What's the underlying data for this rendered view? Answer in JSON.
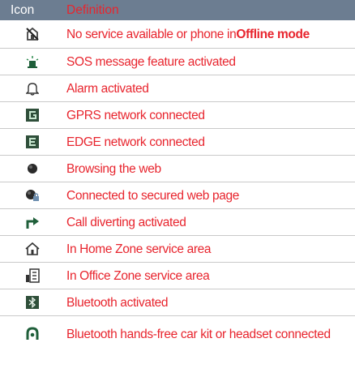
{
  "header": {
    "icon": "Icon",
    "definition": "Definition"
  },
  "rows": [
    {
      "icon": "no-service-icon",
      "text": "No service available or phone in ",
      "highlight": "Offline mode"
    },
    {
      "icon": "sos-icon",
      "text": "SOS message feature activated"
    },
    {
      "icon": "alarm-bell-icon",
      "text": "Alarm activated"
    },
    {
      "icon": "gprs-icon",
      "text": "GPRS network connected"
    },
    {
      "icon": "edge-icon",
      "text": "EDGE network connected"
    },
    {
      "icon": "globe-icon",
      "text": "Browsing the web"
    },
    {
      "icon": "secure-globe-icon",
      "text": "Connected to secured web page"
    },
    {
      "icon": "call-divert-icon",
      "text": "Call diverting activated"
    },
    {
      "icon": "home-zone-icon",
      "text": "In Home Zone service area"
    },
    {
      "icon": "office-zone-icon",
      "text": "In Office Zone service area"
    },
    {
      "icon": "bluetooth-icon",
      "text": "Bluetooth activated"
    },
    {
      "icon": "headset-icon",
      "text": "Bluetooth hands-free car kit or headset connected"
    }
  ],
  "colors": {
    "header_bg": "#6c7d91",
    "text": "#e8252e",
    "divider": "#c9c9c9"
  }
}
